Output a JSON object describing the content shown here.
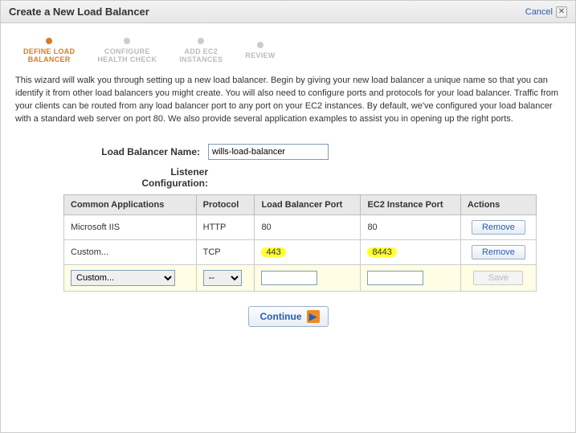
{
  "dialog": {
    "title": "Create a New Load Balancer",
    "cancel": "Cancel"
  },
  "steps": [
    {
      "label": "DEFINE LOAD\nBALANCER",
      "active": true
    },
    {
      "label": "CONFIGURE\nHEALTH CHECK",
      "active": false
    },
    {
      "label": "ADD EC2\nINSTANCES",
      "active": false
    },
    {
      "label": "REVIEW",
      "active": false
    }
  ],
  "intro": "This wizard will walk you through setting up a new load balancer. Begin by giving your new load balancer a unique name so that you can identify it from other load balancers you might create. You will also need to configure ports and protocols for your load balancer. Traffic from your clients can be routed from any load balancer port to any port on your EC2 instances. By default, we've configured your load balancer with a standard web server on port 80. We also provide several application examples to assist you in opening up the right ports.",
  "form": {
    "name_label": "Load Balancer Name:",
    "name_value": "wills-load-balancer",
    "listener_label": "Listener\nConfiguration:"
  },
  "table": {
    "headers": [
      "Common Applications",
      "Protocol",
      "Load Balancer Port",
      "EC2 Instance Port",
      "Actions"
    ],
    "rows": [
      {
        "app": "Microsoft IIS",
        "protocol": "HTTP",
        "lb_port": "80",
        "ec2_port": "80",
        "action": "Remove",
        "highlight": false
      },
      {
        "app": "Custom...",
        "protocol": "TCP",
        "lb_port": "443",
        "ec2_port": "8443",
        "action": "Remove",
        "highlight": true
      }
    ],
    "input_row": {
      "app_selected": "Custom...",
      "protocol_selected": "--",
      "lb_port": "",
      "ec2_port": "",
      "action": "Save"
    }
  },
  "continue": "Continue"
}
